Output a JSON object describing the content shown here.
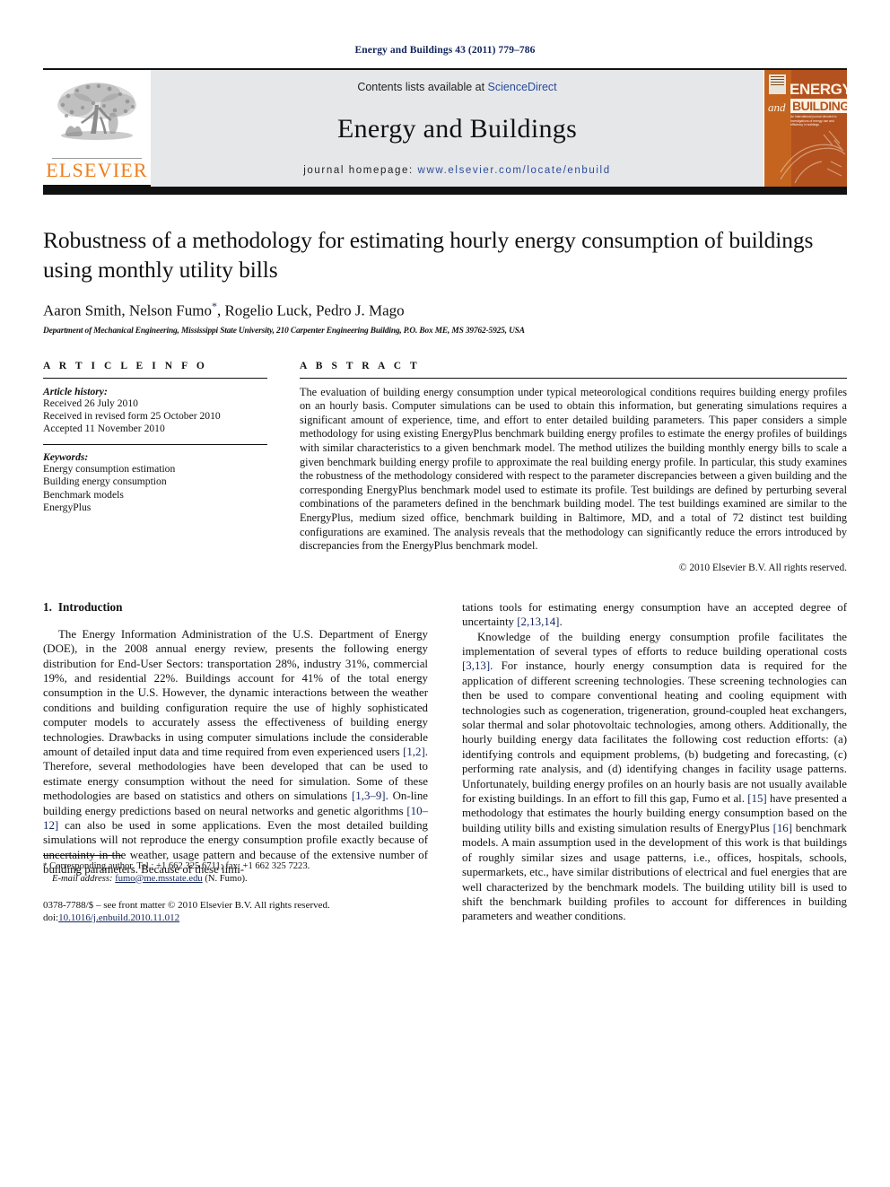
{
  "running_head": "Energy and Buildings 43 (2011) 779–786",
  "masthead": {
    "publisher_name": "ELSEVIER",
    "contents_prefix": "Contents lists available at ",
    "contents_link": "ScienceDirect",
    "journal_name": "Energy and Buildings",
    "homepage_label": "journal homepage: ",
    "homepage_url": "www.elsevier.com/locate/enbuild",
    "cover": {
      "energy": "ENERGY",
      "and": "and",
      "buildings": "BUILDINGS",
      "subtitle": "An international journal devoted to investigations of energy use and efficiency in buildings"
    }
  },
  "article": {
    "title": "Robustness of a methodology for estimating hourly energy consumption of buildings using monthly utility bills",
    "authors": "Aaron Smith, Nelson Fumo",
    "authors_tail": ", Rogelio Luck, Pedro J. Mago",
    "corresponding_marker": "*",
    "affiliation": "Department of Mechanical Engineering, Mississippi State University, 210 Carpenter Engineering Building, P.O. Box ME, MS 39762-5925, USA"
  },
  "article_info": {
    "label": "A R T I C L E    I N F O",
    "history_label": "Article history:",
    "history": [
      "Received 26 July 2010",
      "Received in revised form 25 October 2010",
      "Accepted 11 November 2010"
    ],
    "keywords_label": "Keywords:",
    "keywords": [
      "Energy consumption estimation",
      "Building energy consumption",
      "Benchmark models",
      "EnergyPlus"
    ]
  },
  "abstract": {
    "label": "A B S T R A C T",
    "text": "The evaluation of building energy consumption under typical meteorological conditions requires building energy profiles on an hourly basis. Computer simulations can be used to obtain this information, but generating simulations requires a significant amount of experience, time, and effort to enter detailed building parameters. This paper considers a simple methodology for using existing EnergyPlus benchmark building energy profiles to estimate the energy profiles of buildings with similar characteristics to a given benchmark model. The method utilizes the building monthly energy bills to scale a given benchmark building energy profile to approximate the real building energy profile. In particular, this study examines the robustness of the methodology considered with respect to the parameter discrepancies between a given building and the corresponding EnergyPlus benchmark model used to estimate its profile. Test buildings are defined by perturbing several combinations of the parameters defined in the benchmark building model. The test buildings examined are similar to the EnergyPlus, medium sized office, benchmark building in Baltimore, MD, and a total of 72 distinct test building configurations are examined. The analysis reveals that the methodology can significantly reduce the errors introduced by discrepancies from the EnergyPlus benchmark model.",
    "copyright": "© 2010 Elsevier B.V. All rights reserved."
  },
  "introduction": {
    "heading_number": "1.",
    "heading_title": "Introduction",
    "left_p1_a": "The Energy Information Administration of the U.S. Department of Energy (DOE), in the 2008 annual energy review, presents the following energy distribution for End-User Sectors: transportation 28%, industry 31%, commercial 19%, and residential 22%. Buildings account for 41% of the total energy consumption in the U.S. However, the dynamic interactions between the weather conditions and building configuration require the use of highly sophisticated computer models to accurately assess the effectiveness of building energy technologies. Drawbacks in using computer simulations include the considerable amount of detailed input data and time required from even experienced users ",
    "ref_1_2": "[1,2]",
    "left_p1_b": ". Therefore, several methodologies have been developed that can be used to estimate energy consumption without the need for simulation. Some of these methodologies are based on statistics and others on simulations ",
    "ref_1_3_9": "[1,3–9]",
    "left_p1_c": ". On-line building energy predictions based on neural networks and genetic algorithms ",
    "ref_10_12": "[10–12]",
    "left_p1_d": " can also be used in some applications. Even the most detailed building simulations will not reproduce the energy consumption profile exactly because of uncertainty in the weather, usage pattern and because of the extensive number of building parameters. Because of these limi-",
    "right_p1_cont": "tations tools for estimating energy consumption have an accepted degree of uncertainty ",
    "ref_2_13_14": "[2,13,14]",
    "right_p1_end": ".",
    "right_p2_a": "Knowledge of the building energy consumption profile facilitates the implementation of several types of efforts to reduce building operational costs ",
    "ref_3_13": "[3,13]",
    "right_p2_b": ". For instance, hourly energy consumption data is required for the application of different screening technologies. These screening technologies can then be used to compare conventional heating and cooling equipment with technologies such as cogeneration, trigeneration, ground-coupled heat exchangers, solar thermal and solar photovoltaic technologies, among others. Additionally, the hourly building energy data facilitates the following cost reduction efforts: (a) identifying controls and equipment problems, (b) budgeting and forecasting, (c) performing rate analysis, and (d) identifying changes in facility usage patterns. Unfortunately, building energy profiles on an hourly basis are not usually available for existing buildings. In an effort to fill this gap, Fumo et al. ",
    "ref_15": "[15]",
    "right_p2_c": " have presented a methodology that estimates the hourly building energy consumption based on the building utility bills and existing simulation results of EnergyPlus ",
    "ref_16": "[16]",
    "right_p2_d": " benchmark models. A main assumption used in the development of this work is that buildings of roughly similar sizes and usage patterns, i.e., offices, hospitals, schools, supermarkets, etc., have similar distributions of electrical and fuel energies that are well characterized by the benchmark models. The building utility bill is used to shift the benchmark building profiles to account for differences in building parameters and weather conditions."
  },
  "footnote": {
    "marker": "*",
    "corresponding": " Corresponding author. Tel.: +1 662 325 6711; fax: +1 662 325 7223.",
    "email_label": "E-mail address:",
    "email": "fumo@me.msstate.edu",
    "email_suffix": " (N. Fumo)."
  },
  "imprint": {
    "issn_line": "0378-7788/$ – see front matter © 2010 Elsevier B.V. All rights reserved.",
    "doi_label": "doi:",
    "doi": "10.1016/j.enbuild.2010.11.012"
  },
  "colors": {
    "link_blue": "#12245c",
    "sciencedirect_blue": "#2a4b9b",
    "elsevier_orange": "#ef7d1a",
    "band_grey": "#e6e7e9",
    "cover_rust": "#b4521f"
  }
}
